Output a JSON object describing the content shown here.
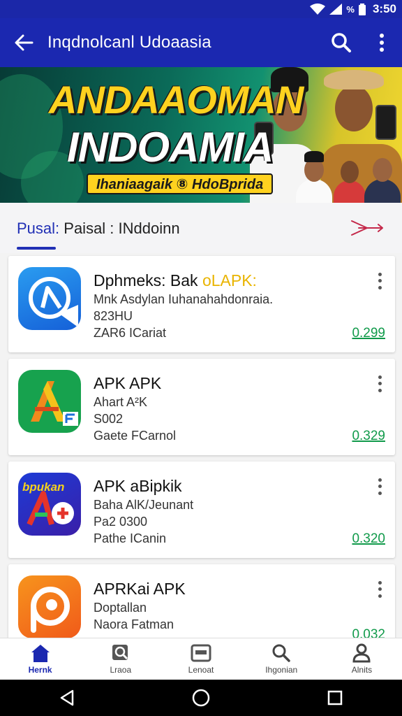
{
  "status_bar": {
    "battery_text": "%",
    "time": "3:50"
  },
  "app_bar": {
    "title": "Inqdnolcanl Udoaasia",
    "icons": [
      "back-arrow-icon",
      "search-icon",
      "more-vert-icon"
    ]
  },
  "banner": {
    "title_line1": "ANDAAOMAN",
    "title_line2": "INDOAMIA",
    "pill_text": "Ihaniaagaik ⑧ HdoBprida"
  },
  "section": {
    "label_accent": "Pusal:",
    "label_rest": " Paisal : INddoinn"
  },
  "apps": [
    {
      "name": "Dphmeks: Bak ",
      "name_highlight": "oLAPK:",
      "line1": "Mnk Asdylan Iuhanahahdonraia.",
      "line2": "823HU",
      "line3": "ZAR6 ICariat",
      "price": "0.299"
    },
    {
      "name": "APK APK",
      "name_highlight": "",
      "line1": "Ahart A²K",
      "line2": "S002",
      "line3": "Gaete FCarnol",
      "price": "0.329"
    },
    {
      "name": "APK aBipkik",
      "name_highlight": "",
      "line1": "Baha AlK/Jeunant",
      "line2": "Pa2 0300",
      "line3": "Pathe ICanin",
      "price": "0.320"
    },
    {
      "name": "APRKai APK",
      "name_highlight": "",
      "line1": "Doptallan",
      "line2": "Naora Fatman",
      "line3": "",
      "price": "0.032"
    }
  ],
  "bottom_nav": [
    {
      "label": "Hernk",
      "icon": "home-icon",
      "active": true
    },
    {
      "label": "Lraoa",
      "icon": "search-person-icon",
      "active": false
    },
    {
      "label": "Lenoat",
      "icon": "card-icon",
      "active": false
    },
    {
      "label": "Ihgonian",
      "icon": "search-icon",
      "active": false
    },
    {
      "label": "Alnits",
      "icon": "profile-icon",
      "active": false
    }
  ],
  "colors": {
    "primary": "#1b28b0",
    "price": "#109a4a",
    "highlight": "#e9b400",
    "banner_yellow": "#ffd21f"
  }
}
